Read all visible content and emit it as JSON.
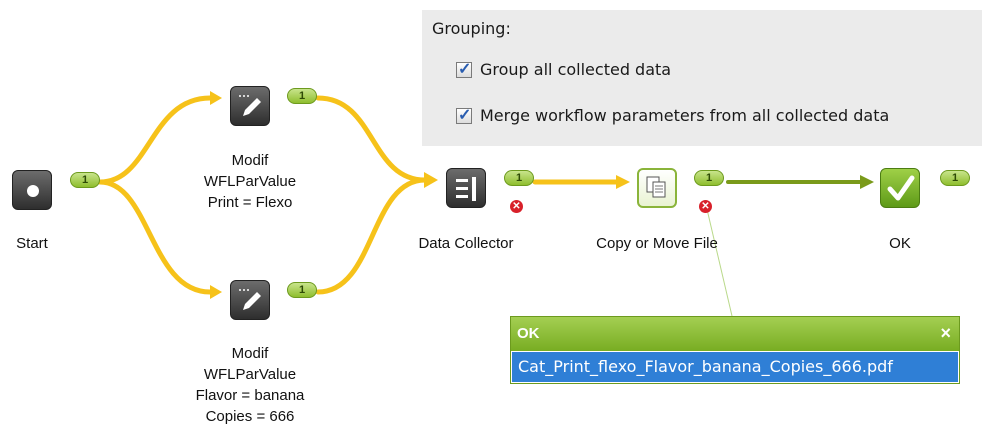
{
  "grouping": {
    "title": "Grouping:",
    "options": [
      {
        "label": "Group all collected data",
        "checked": true
      },
      {
        "label": "Merge workflow parameters from all collected data",
        "checked": true
      }
    ]
  },
  "nodes": {
    "start": {
      "label": "Start",
      "badge": "1"
    },
    "modif_top": {
      "label": "Modif\nWFLParValue\nPrint = Flexo",
      "badge": "1"
    },
    "modif_bottom": {
      "label": "Modif\nWFLParValue\nFlavor = banana\nCopies = 666",
      "badge": "1"
    },
    "data_collector": {
      "label": "Data Collector",
      "badge": "1",
      "error_icon": "error-x"
    },
    "copy_move": {
      "label": "Copy or Move File",
      "badge": "1",
      "error_icon": "error-x"
    },
    "ok": {
      "label": "OK",
      "badge": "1"
    }
  },
  "popup": {
    "title": "OK",
    "close_glyph": "×",
    "file": "Cat_Print_flexo_Flavor_banana_Copies_666.pdf"
  },
  "colors": {
    "flow_active": "#f5c518",
    "flow_done": "#7a9a1a",
    "badge_green": "#8fbe2e",
    "error_red": "#d8202a",
    "selection_blue": "#2f7fd6"
  }
}
